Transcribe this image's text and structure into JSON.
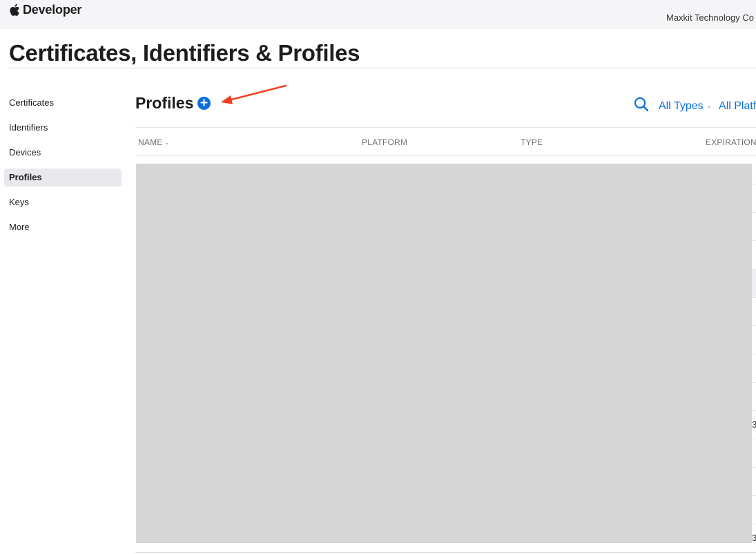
{
  "header": {
    "brand_icon": "apple-logo-icon",
    "brand": "Developer",
    "account_name": "Maxkit Technology Co"
  },
  "page_title": "Certificates, Identifiers & Profiles",
  "sidebar": {
    "items": [
      {
        "label": "Certificates",
        "active": false
      },
      {
        "label": "Identifiers",
        "active": false
      },
      {
        "label": "Devices",
        "active": false
      },
      {
        "label": "Profiles",
        "active": true
      },
      {
        "label": "Keys",
        "active": false
      },
      {
        "label": "More",
        "active": false
      }
    ]
  },
  "section": {
    "title": "Profiles",
    "add_icon": "plus-circle-icon",
    "annotation_icon": "arrow-icon",
    "search_icon": "search-icon",
    "type_filter": "All Types",
    "platform_filter": "All Platf"
  },
  "table": {
    "columns": [
      "NAME",
      "PLATFORM",
      "TYPE",
      "EXPIRATION"
    ],
    "sort_icon": "chevron-down-icon",
    "edge_glyphs": [
      "3",
      "3"
    ]
  },
  "colors": {
    "accent": "#0a6fdb",
    "annotation_arrow": "#f0401f",
    "redaction": "#d6d6d6"
  }
}
